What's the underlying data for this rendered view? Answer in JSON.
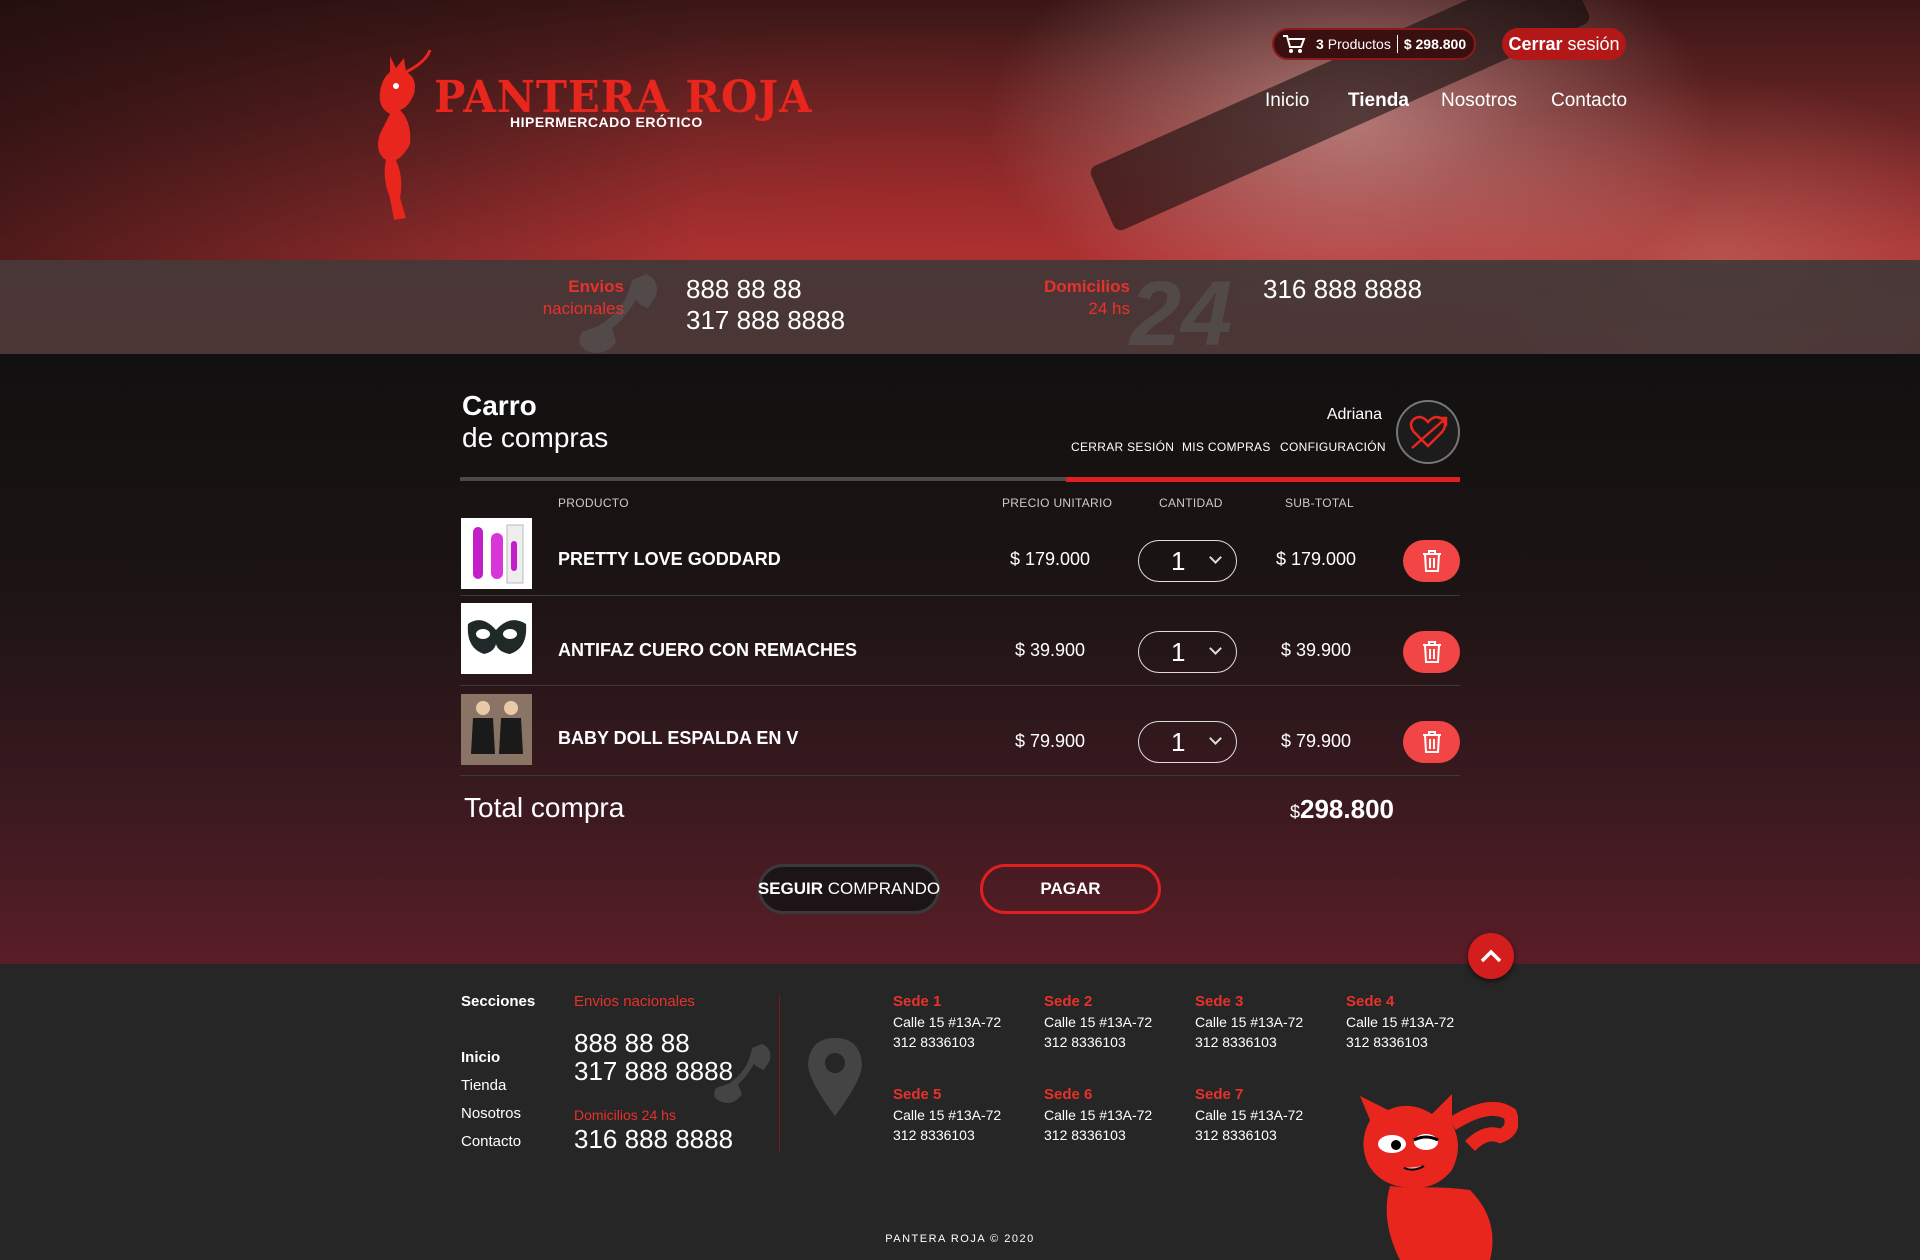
{
  "header": {
    "logo_title": "PANTERA ROJA",
    "logo_subtitle": "HIPERMERCADO ERÓTICO",
    "cart_count": "3",
    "cart_label": "Productos",
    "cart_total": "$ 298.800",
    "logout_bold": "Cerrar",
    "logout_rest": " sesión",
    "nav": [
      "Inicio",
      "Tienda",
      "Nosotros",
      "Contacto"
    ],
    "active_nav": "Tienda"
  },
  "infobar": {
    "envios_l1": "Envios",
    "envios_l2": "nacionales",
    "envios_p1": "888 88 88",
    "envios_p2": "317 888 8888",
    "dom_l1": "Domicilios",
    "dom_l2": "24 hs",
    "dom_p1": "316 888 8888",
    "ghost_24": "24"
  },
  "cart": {
    "title_line1": "Carro",
    "title_line2": "de compras",
    "user_name": "Adriana",
    "links": [
      "CERRAR SESIÓN",
      "MIS COMPRAS",
      "CONFIGURACIÓN"
    ],
    "columns": [
      "PRODUCTO",
      "PRECIO UNITARIO",
      "CANTIDAD",
      "SUB-TOTAL"
    ],
    "items": [
      {
        "name": "PRETTY LOVE GODDARD",
        "unit_price": "$ 179.000",
        "qty": "1",
        "subtotal": "$ 179.000",
        "thumb_icon": "vibrator-product-icon"
      },
      {
        "name": "ANTIFAZ CUERO CON REMACHES",
        "unit_price": "$ 39.900",
        "qty": "1",
        "subtotal": "$ 39.900",
        "thumb_icon": "mask-product-icon"
      },
      {
        "name": "BABY DOLL ESPALDA EN V",
        "unit_price": "$ 79.900",
        "qty": "1",
        "subtotal": "$ 79.900",
        "thumb_icon": "lingerie-product-icon"
      }
    ],
    "total_label": "Total compra",
    "total_currency": "$",
    "total_value": "298.800",
    "btn_continue_bold": "SEGUIR",
    "btn_continue_rest": " COMPRANDO",
    "btn_pay": "PAGAR"
  },
  "footer": {
    "sections_title": "Secciones",
    "sections": [
      "Inicio",
      "Tienda",
      "Nosotros",
      "Contacto"
    ],
    "envios_title": "Envios nacionales",
    "envios_p1": "888 88 88",
    "envios_p2": "317 888 8888",
    "dom_title": "Domicilios 24 hs",
    "dom_p1": "316 888 8888",
    "sedes": [
      {
        "name": "Sede 1",
        "addr": "Calle 15 #13A-72",
        "phone": "312 8336103"
      },
      {
        "name": "Sede 2",
        "addr": "Calle 15 #13A-72",
        "phone": "312 8336103"
      },
      {
        "name": "Sede 3",
        "addr": "Calle 15 #13A-72",
        "phone": "312 8336103"
      },
      {
        "name": "Sede 4",
        "addr": "Calle 15 #13A-72",
        "phone": "312 8336103"
      },
      {
        "name": "Sede 5",
        "addr": "Calle 15 #13A-72",
        "phone": "312 8336103"
      },
      {
        "name": "Sede 6",
        "addr": "Calle 15 #13A-72",
        "phone": "312 8336103"
      },
      {
        "name": "Sede 7",
        "addr": "Calle 15 #13A-72",
        "phone": "312 8336103"
      }
    ],
    "copyright": "PANTERA ROJA © 2020"
  },
  "colors": {
    "brand_red": "#e8261d",
    "delete_red": "#f24545",
    "footer_bg": "#262626"
  }
}
